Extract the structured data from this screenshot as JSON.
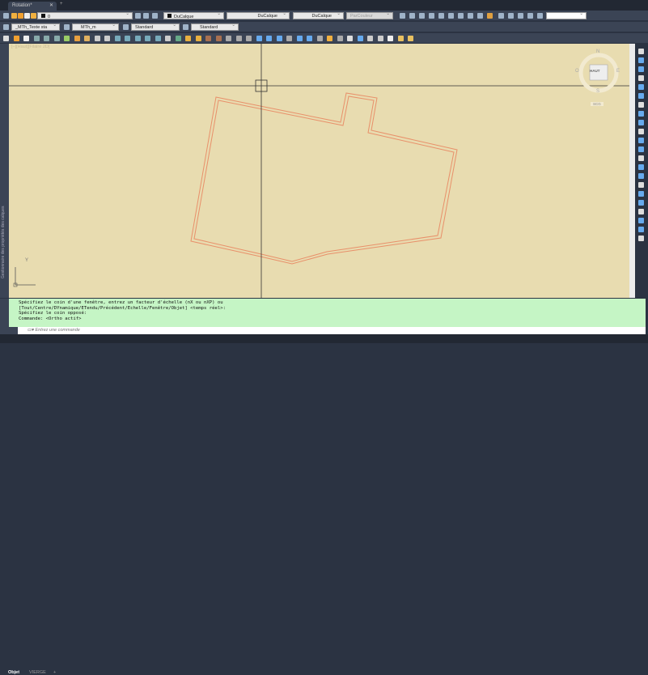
{
  "tab": {
    "title": "Rotation*",
    "close": "✕",
    "new": "+"
  },
  "toolbar1": {
    "layer": "0",
    "color": "DuCalque",
    "linetype": "DuCalque",
    "lineweight": "DuCalque",
    "plotstyle": "ParCouleur",
    "blank": ""
  },
  "toolbar2": {
    "textstyle": "_MTh_Texte sta",
    "dimstyle": "MTh_m",
    "tablestyle": "Standard",
    "mleaderstyle": "Standard"
  },
  "viewport": {
    "label": "[–][Haut][Filaire 2D]",
    "cube_top": "HAUT",
    "north": "N",
    "south": "S",
    "east": "E",
    "west": "O",
    "ucs": "SCG",
    "ucs_y": "Y"
  },
  "sidepanel": {
    "label": "Gestionnaire des propriétés des calques"
  },
  "command": {
    "history": [
      "Spécifiez le coin d'une fenêtre, entrez un facteur d'échelle (nX ou nXP) ou",
      "[Tout/Centre/DYnamique/ETendu/Précédent/Echelle/Fenêtre/Objet] <temps réel>:",
      "Spécifiez le coin opposé:",
      "Commande:  <Ortho actif>"
    ],
    "placeholder": "Entrez une commande"
  },
  "layouts": {
    "model": "Objet",
    "layout1": "VIERGE",
    "add": "+"
  },
  "colors": {
    "canvas": "#e8dcb0",
    "wall": "#e8906a",
    "cmd_bg": "#c5f5c5"
  }
}
